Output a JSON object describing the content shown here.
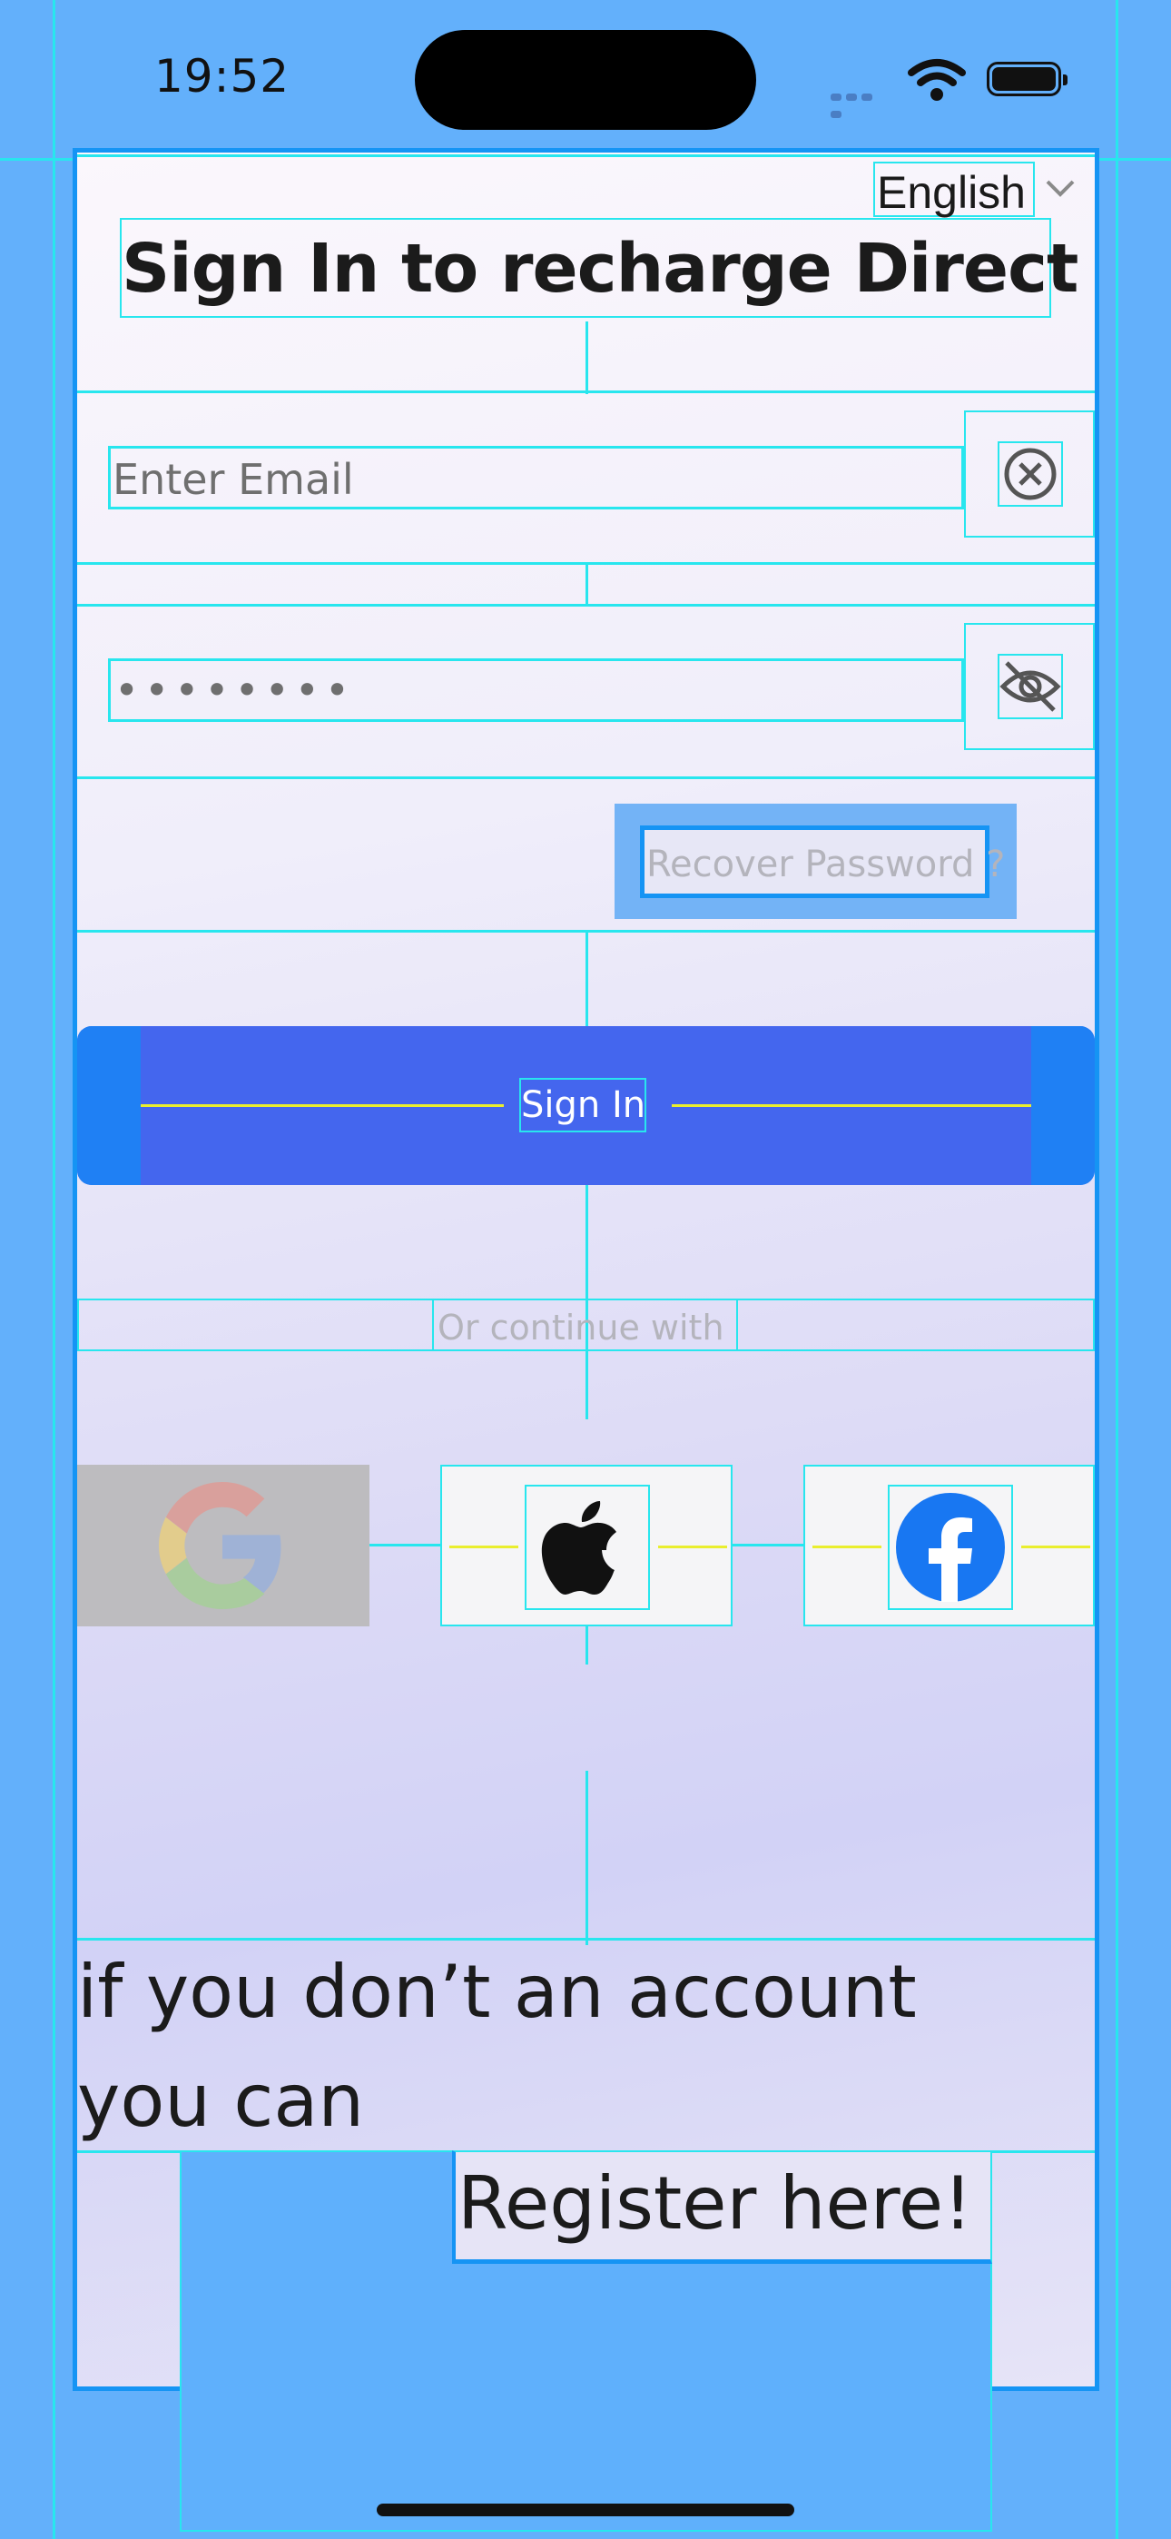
{
  "status_bar": {
    "time": "19:52"
  },
  "language": {
    "selected": "English"
  },
  "header": {
    "title": "Sign In to recharge Direct"
  },
  "email": {
    "placeholder": "Enter Email"
  },
  "password": {
    "value": "••••••••"
  },
  "recover": {
    "label": "Recover Password ?"
  },
  "signin": {
    "label": "Sign In"
  },
  "divider": {
    "label": "Or continue with"
  },
  "social": {
    "providers": [
      "google",
      "apple",
      "facebook"
    ]
  },
  "footer": {
    "line1": "if you don’t an account",
    "line2": "you can",
    "register_label": "Register here!"
  },
  "colors": {
    "primary": "#4466ee",
    "accent": "#1594f4",
    "outline": "#28e6ee",
    "guide": "#e9ee2e",
    "background": "#63b0fb"
  }
}
